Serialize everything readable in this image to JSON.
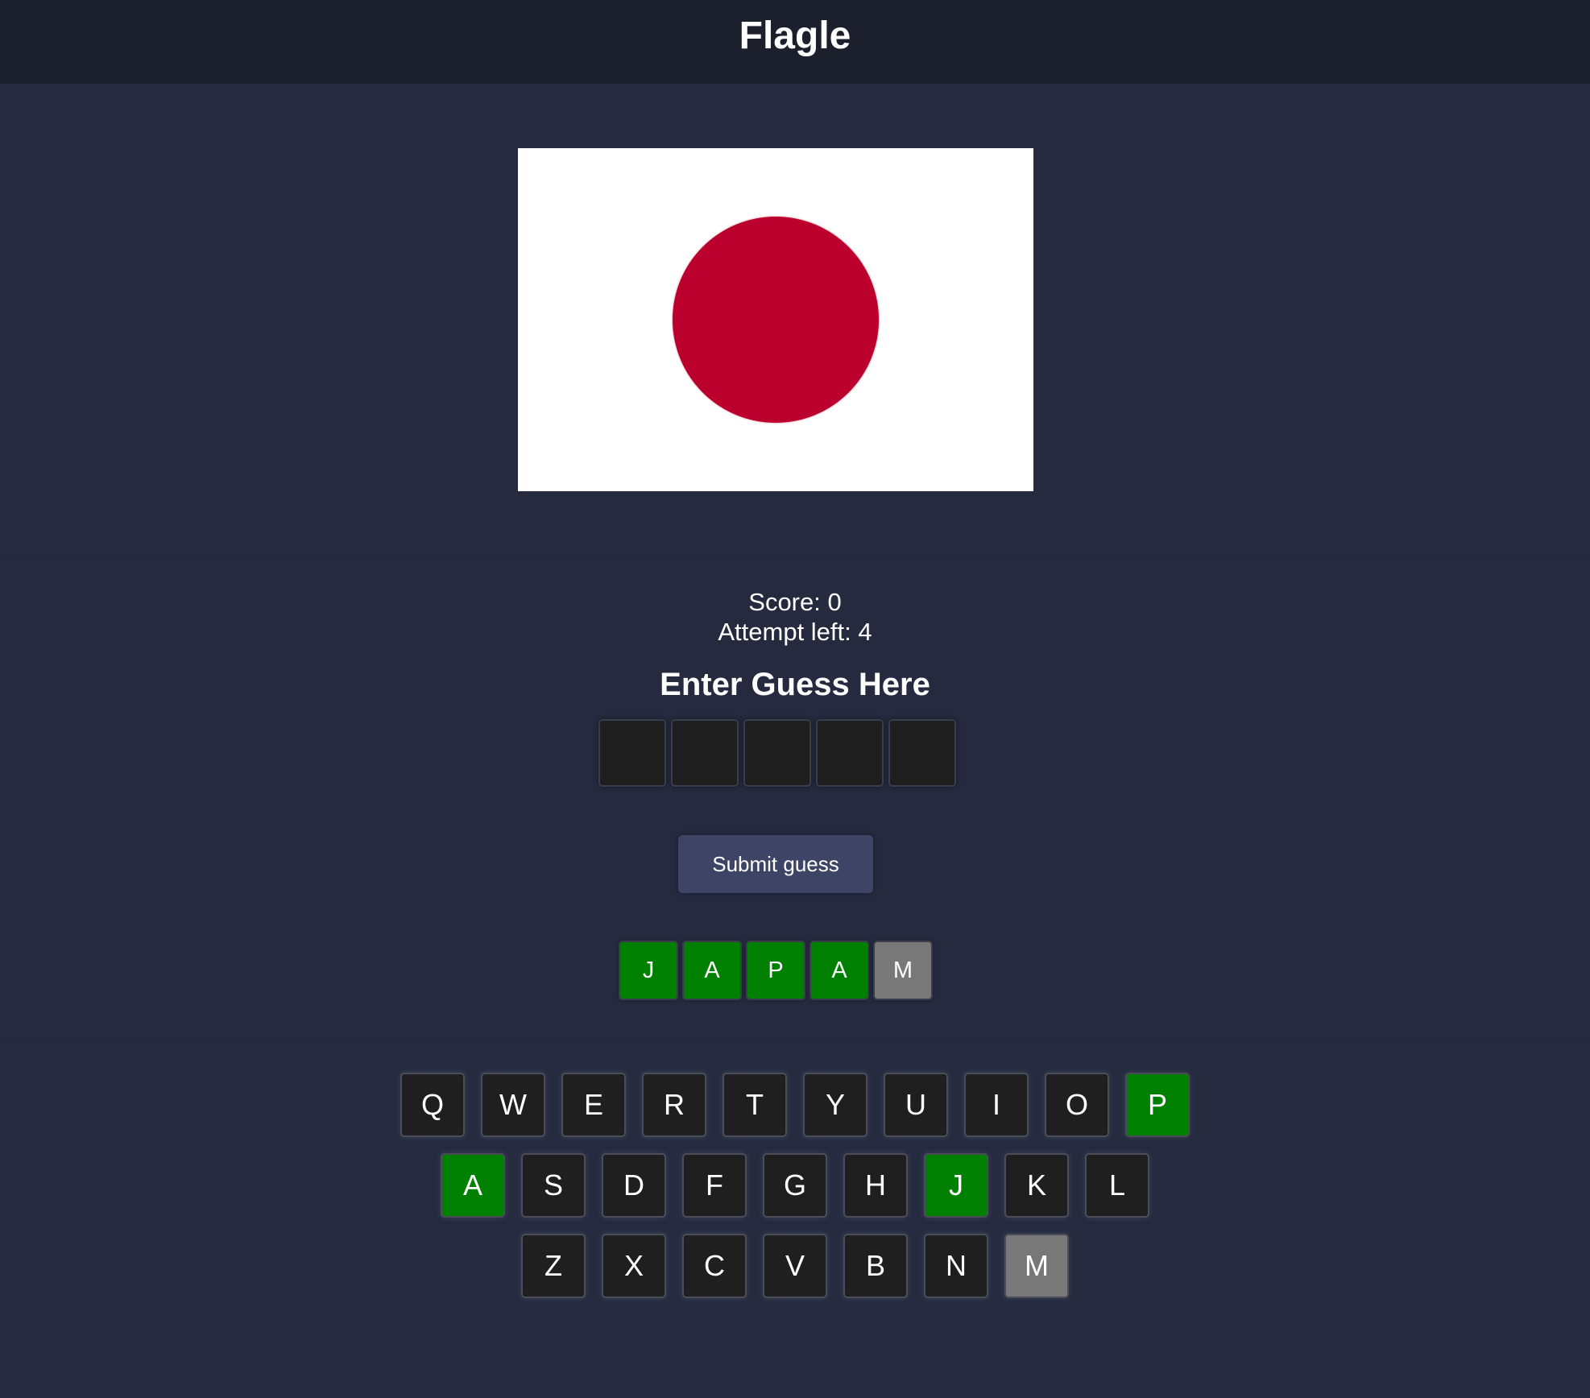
{
  "header": {
    "title": "Flagle"
  },
  "flag": {
    "icon": "japan-flag-icon",
    "background_color": "#ffffff",
    "disc_color": "#bc002d"
  },
  "status": {
    "score_text": "Score: 0",
    "attempts_text": "Attempt left: 4"
  },
  "guess": {
    "prompt": "Enter Guess Here",
    "slots": [
      "",
      "",
      "",
      "",
      ""
    ]
  },
  "submit": {
    "label": "Submit guess"
  },
  "history": [
    {
      "letter": "J",
      "state": "correct"
    },
    {
      "letter": "A",
      "state": "correct"
    },
    {
      "letter": "P",
      "state": "correct"
    },
    {
      "letter": "A",
      "state": "correct"
    },
    {
      "letter": "M",
      "state": "absent"
    }
  ],
  "keyboard": {
    "rows": [
      [
        {
          "letter": "Q",
          "state": "unused"
        },
        {
          "letter": "W",
          "state": "unused"
        },
        {
          "letter": "E",
          "state": "unused"
        },
        {
          "letter": "R",
          "state": "unused"
        },
        {
          "letter": "T",
          "state": "unused"
        },
        {
          "letter": "Y",
          "state": "unused"
        },
        {
          "letter": "U",
          "state": "unused"
        },
        {
          "letter": "I",
          "state": "unused"
        },
        {
          "letter": "O",
          "state": "unused"
        },
        {
          "letter": "P",
          "state": "correct"
        }
      ],
      [
        {
          "letter": "A",
          "state": "correct"
        },
        {
          "letter": "S",
          "state": "unused"
        },
        {
          "letter": "D",
          "state": "unused"
        },
        {
          "letter": "F",
          "state": "unused"
        },
        {
          "letter": "G",
          "state": "unused"
        },
        {
          "letter": "H",
          "state": "unused"
        },
        {
          "letter": "J",
          "state": "correct"
        },
        {
          "letter": "K",
          "state": "unused"
        },
        {
          "letter": "L",
          "state": "unused"
        }
      ],
      [
        {
          "letter": "Z",
          "state": "unused"
        },
        {
          "letter": "X",
          "state": "unused"
        },
        {
          "letter": "C",
          "state": "unused"
        },
        {
          "letter": "V",
          "state": "unused"
        },
        {
          "letter": "B",
          "state": "unused"
        },
        {
          "letter": "N",
          "state": "unused"
        },
        {
          "letter": "M",
          "state": "absent"
        }
      ]
    ]
  },
  "colors": {
    "correct": "#008000",
    "absent": "#787878",
    "unused": "#1f1f1f"
  }
}
